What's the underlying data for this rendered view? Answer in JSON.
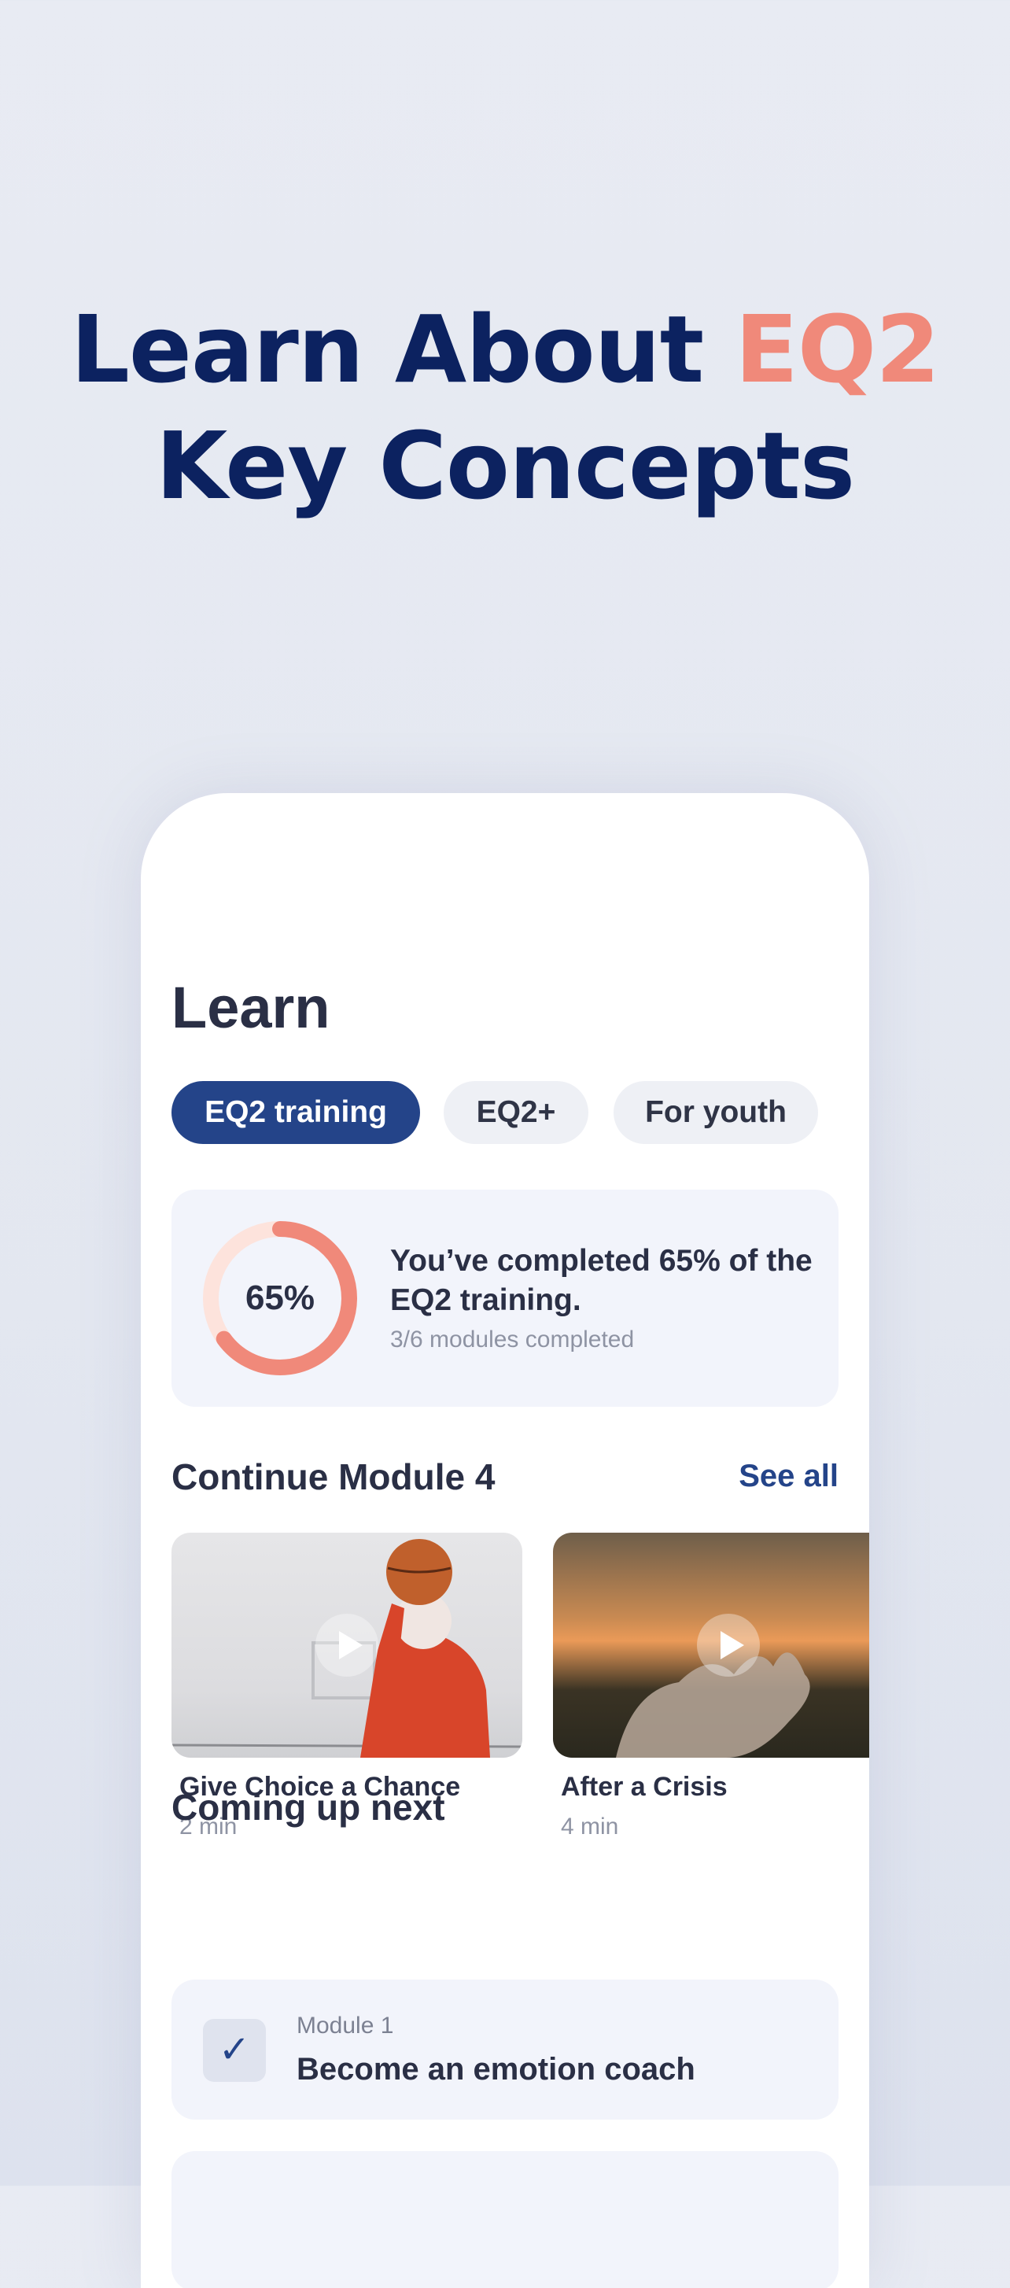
{
  "headline": {
    "line1": "Learn About",
    "accent": "EQ2",
    "line2": "Key Concepts"
  },
  "learn": {
    "title": "Learn",
    "tabs": [
      {
        "label": "EQ2 training",
        "active": true
      },
      {
        "label": "EQ2+",
        "active": false
      },
      {
        "label": "For youth",
        "active": false
      }
    ],
    "progress": {
      "percent": 65,
      "percent_label": "65%",
      "message": "You’ve completed 65% of the EQ2 training.",
      "sub": "3/6 modules completed"
    },
    "continue": {
      "title": "Continue Module 4",
      "see_all": "See all",
      "items": [
        {
          "title": "Give Choice a Chance",
          "duration": "2 min"
        },
        {
          "title": "After a Crisis",
          "duration": "4 min"
        }
      ]
    },
    "coming_up": {
      "title": "Coming up next",
      "items": [
        {
          "label": "Module 1",
          "title": "Become an emotion coach",
          "completed": true
        }
      ]
    }
  },
  "colors": {
    "navy": "#0c2260",
    "accent": "#f0897a",
    "primary": "#244489"
  },
  "icons": {
    "play": "play-icon",
    "check": "checkmark-icon"
  }
}
